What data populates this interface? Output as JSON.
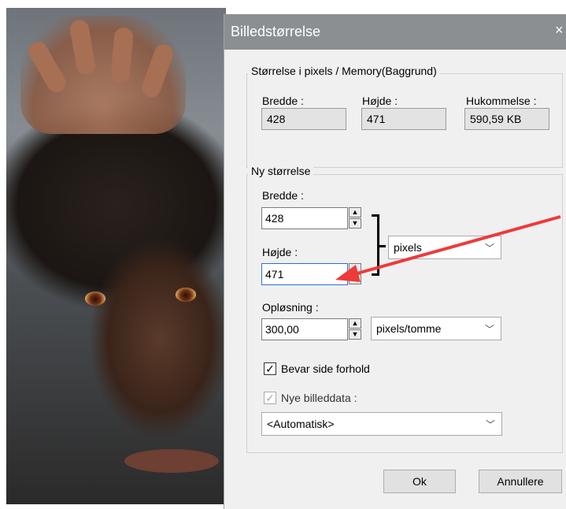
{
  "dialog": {
    "title": "Billedstørrelse",
    "close_icon": "×",
    "pixels_group": {
      "title": "Størrelse i pixels / Memory(Baggrund)",
      "width_label": "Bredde :",
      "width_value": "428",
      "height_label": "Højde :",
      "height_value": "471",
      "memory_label": "Hukommelse :",
      "memory_value": "590,59 KB"
    },
    "new_size_group": {
      "title": "Ny størrelse",
      "width_label": "Bredde :",
      "width_value": "428",
      "height_label": "Højde :",
      "height_value": "471",
      "unit_select": "pixels",
      "resolution_label": "Opløsning :",
      "resolution_value": "300,00",
      "resolution_unit": "pixels/tomme",
      "keep_ratio_label": "Bevar side forhold",
      "keep_ratio_checked": true,
      "new_data_label": "Nye billeddata :",
      "new_data_checked": true,
      "new_data_select": "<Automatisk>"
    },
    "buttons": {
      "ok": "Ok",
      "cancel": "Annullere"
    }
  },
  "annotation": {
    "arrow_color": "#ee3a3a"
  }
}
